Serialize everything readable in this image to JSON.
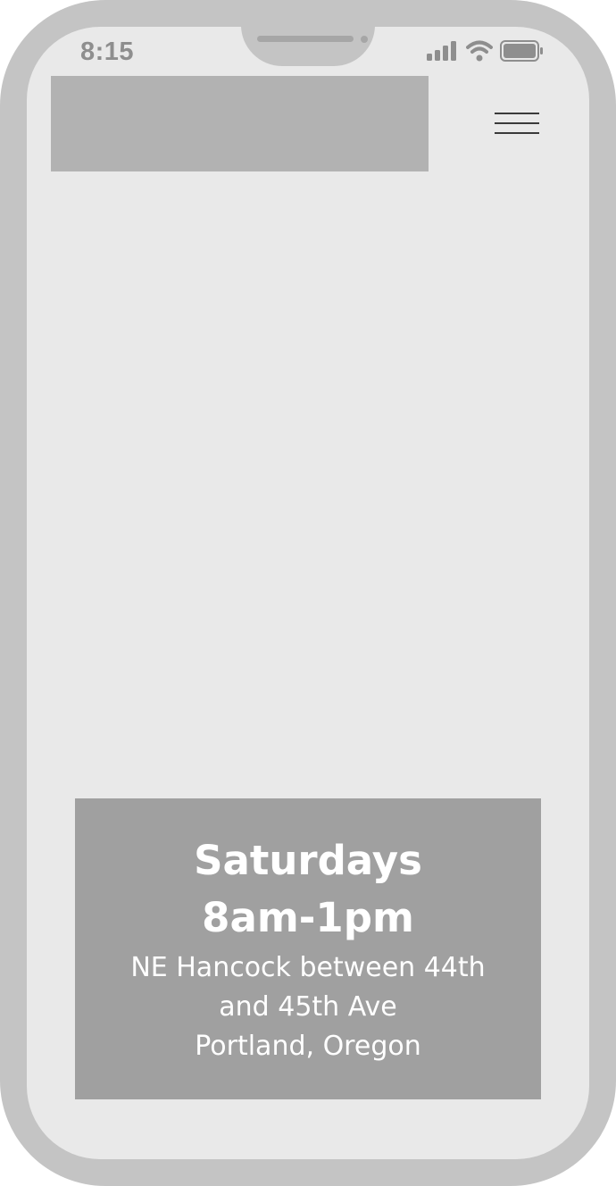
{
  "status_bar": {
    "time": "8:15",
    "icons": [
      "signal-icon",
      "wifi-icon",
      "battery-icon"
    ]
  },
  "header": {
    "logo": "",
    "menu_icon": "hamburger-menu-icon"
  },
  "info": {
    "day": "Saturdays",
    "hours": "8am-1pm",
    "address_line1": "NE Hancock between 44th and 45th Ave",
    "city": "Portland, Oregon"
  },
  "colors": {
    "frame": "#c4c4c4",
    "screen": "#e9e9e9",
    "logo_placeholder": "#b2b2b2",
    "info_box": "#a0a0a0",
    "text_light": "#ffffff"
  }
}
